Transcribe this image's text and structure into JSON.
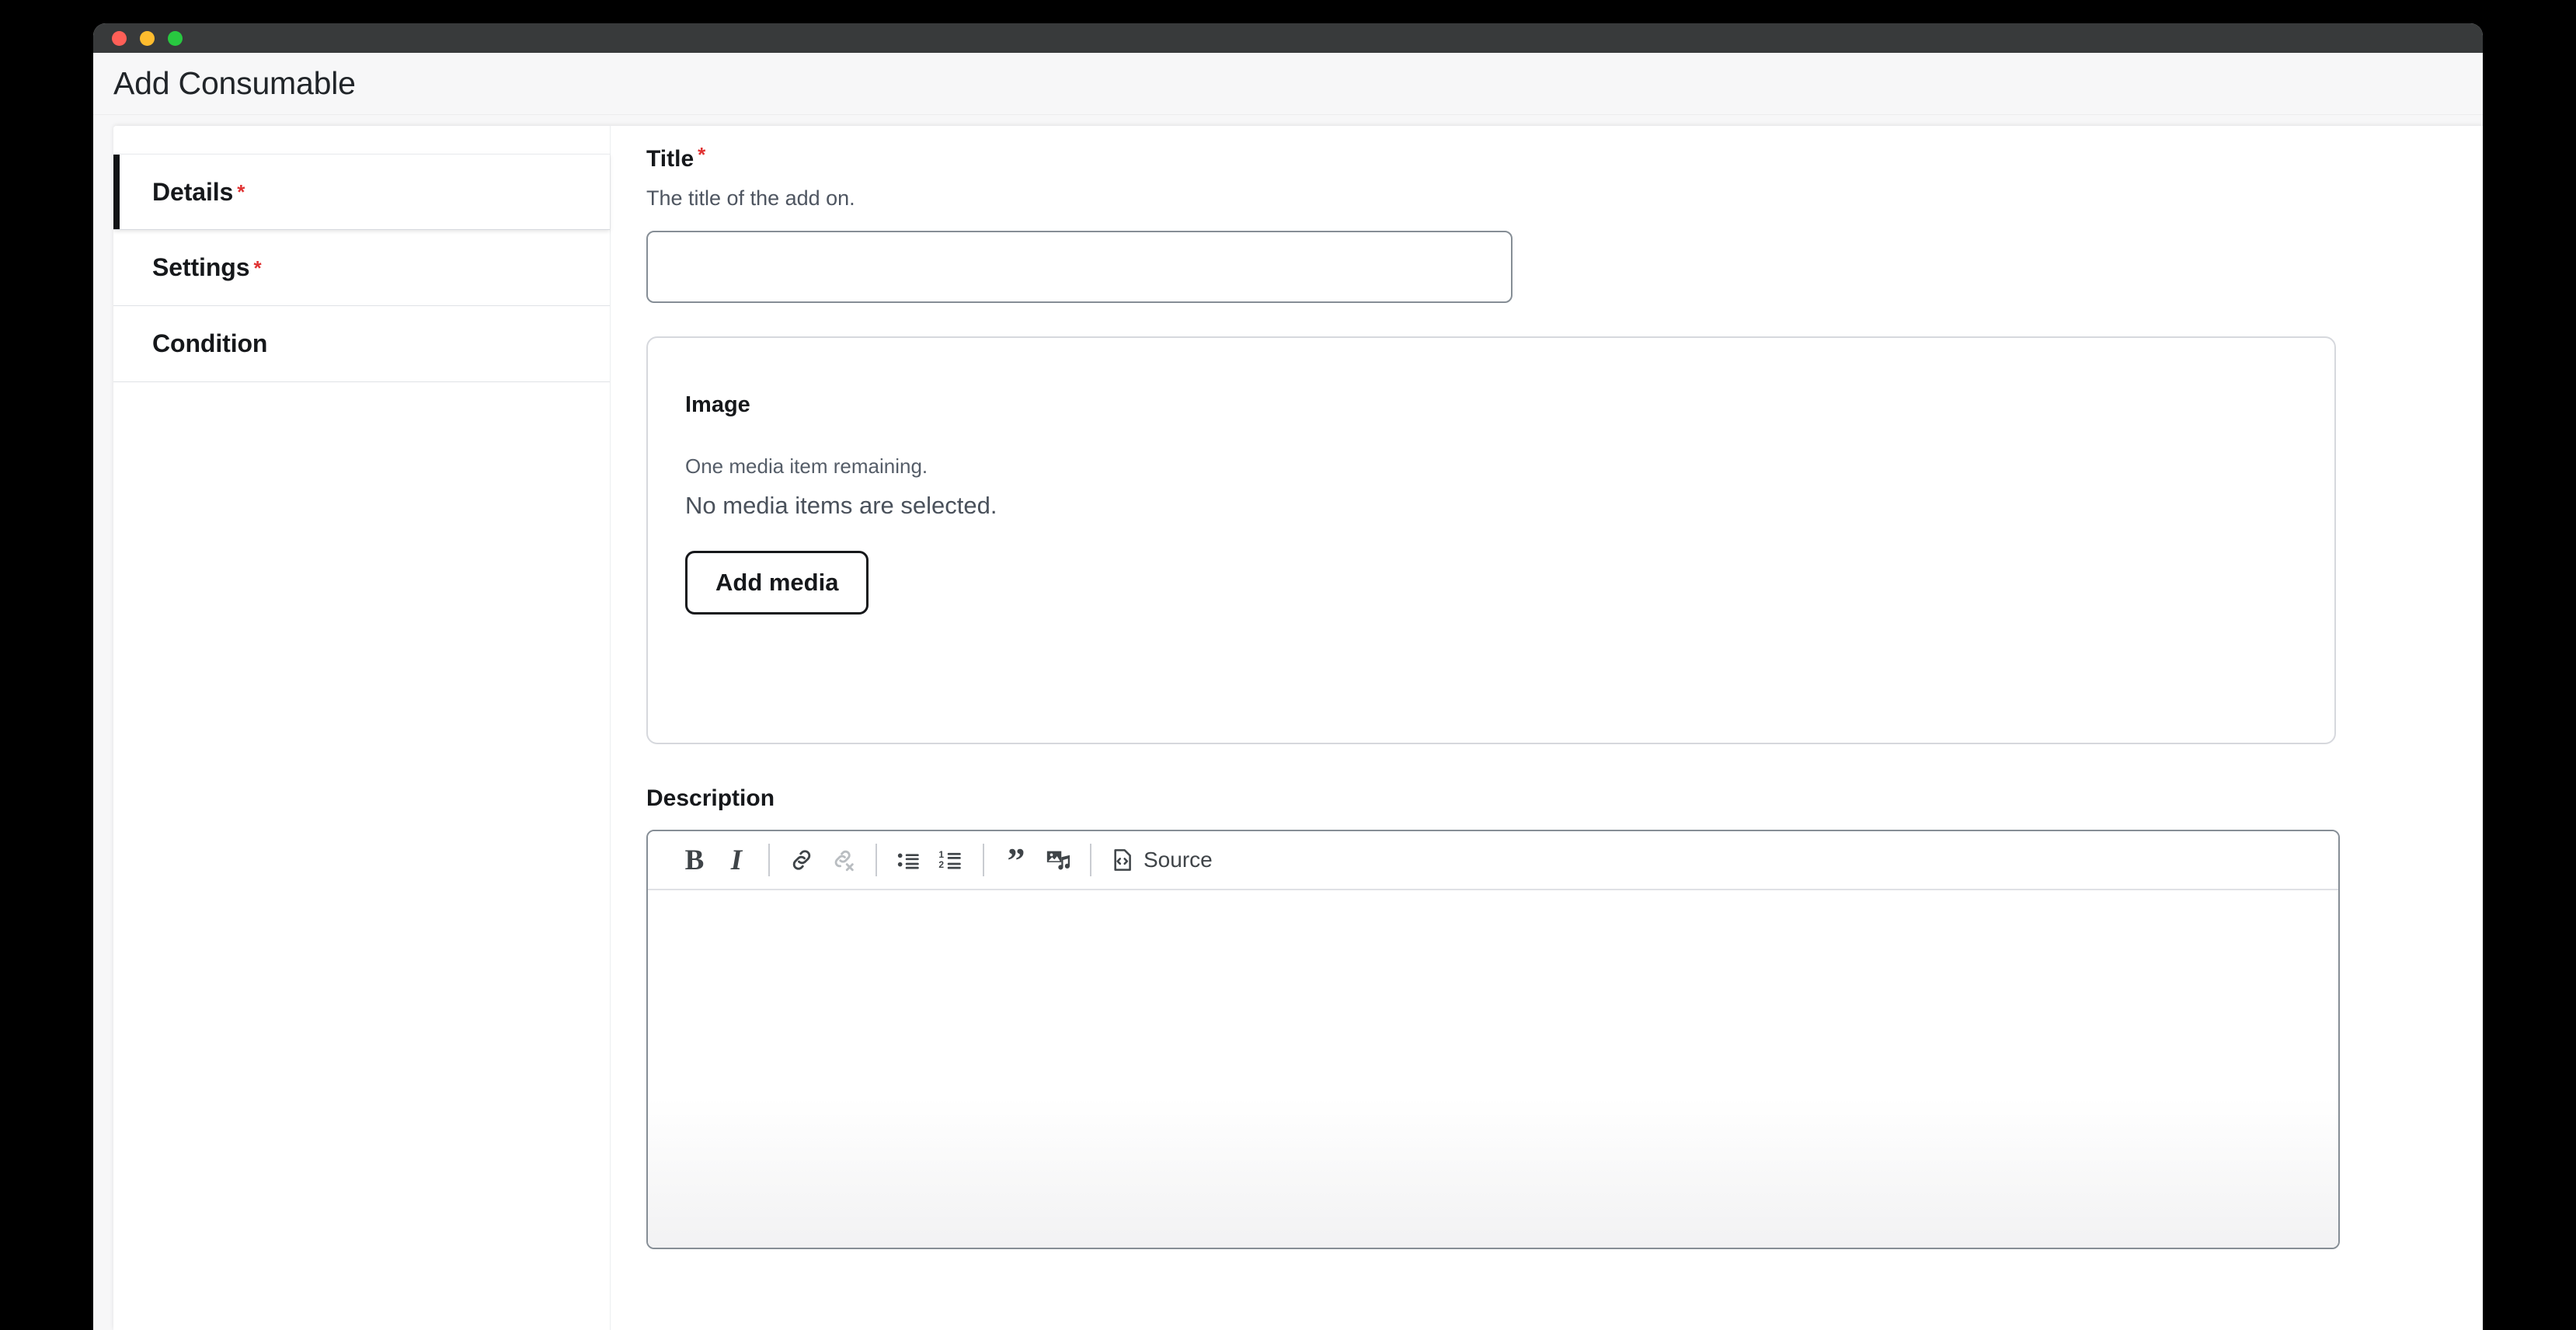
{
  "window": {
    "traffic_lights": [
      "close-button",
      "minimize-button",
      "maximize-button"
    ]
  },
  "header": {
    "title": "Add Consumable"
  },
  "tabs": [
    {
      "label": "Details",
      "required": true,
      "required_marker": "*",
      "active": true,
      "name": "tab-details"
    },
    {
      "label": "Settings",
      "required": true,
      "required_marker": "*",
      "active": false,
      "name": "tab-settings"
    },
    {
      "label": "Condition",
      "required": false,
      "required_marker": "",
      "active": false,
      "name": "tab-condition"
    }
  ],
  "form": {
    "title_field": {
      "label": "Title",
      "required_marker": "*",
      "help": "The title of the add on.",
      "value": "",
      "placeholder": ""
    },
    "image_card": {
      "label": "Image",
      "remaining_text": "One media item remaining.",
      "empty_text": "No media items are selected.",
      "add_button": "Add media"
    },
    "description_field": {
      "label": "Description",
      "value": "",
      "toolbar": [
        {
          "name": "bold-icon",
          "glyph": "B",
          "label": "",
          "disabled": false
        },
        {
          "name": "italic-icon",
          "glyph": "I",
          "label": "",
          "disabled": false
        },
        {
          "name": "separator",
          "glyph": "",
          "label": "",
          "disabled": false
        },
        {
          "name": "link-icon",
          "glyph": "",
          "label": "",
          "disabled": false
        },
        {
          "name": "unlink-icon",
          "glyph": "",
          "label": "",
          "disabled": true
        },
        {
          "name": "separator",
          "glyph": "",
          "label": "",
          "disabled": false
        },
        {
          "name": "bulleted-list-icon",
          "glyph": "",
          "label": "",
          "disabled": false
        },
        {
          "name": "numbered-list-icon",
          "glyph": "",
          "label": "",
          "disabled": false
        },
        {
          "name": "separator",
          "glyph": "",
          "label": "",
          "disabled": false
        },
        {
          "name": "blockquote-icon",
          "glyph": "”",
          "label": "",
          "disabled": false
        },
        {
          "name": "media-icon",
          "glyph": "",
          "label": "",
          "disabled": false
        },
        {
          "name": "separator",
          "glyph": "",
          "label": "",
          "disabled": false
        },
        {
          "name": "source-button",
          "glyph": "",
          "label": "Source",
          "disabled": false
        }
      ]
    }
  },
  "colors": {
    "titlebar": "#383a3b",
    "page_background": "#f7f7f8",
    "accent_required": "#e03131",
    "active_tab_bar": "#111315",
    "text_primary": "#16181b",
    "text_muted": "#4e5560",
    "border": "#868e96",
    "toolbar_icon": "#3f4448",
    "toolbar_icon_disabled": "#b9bdc1"
  }
}
